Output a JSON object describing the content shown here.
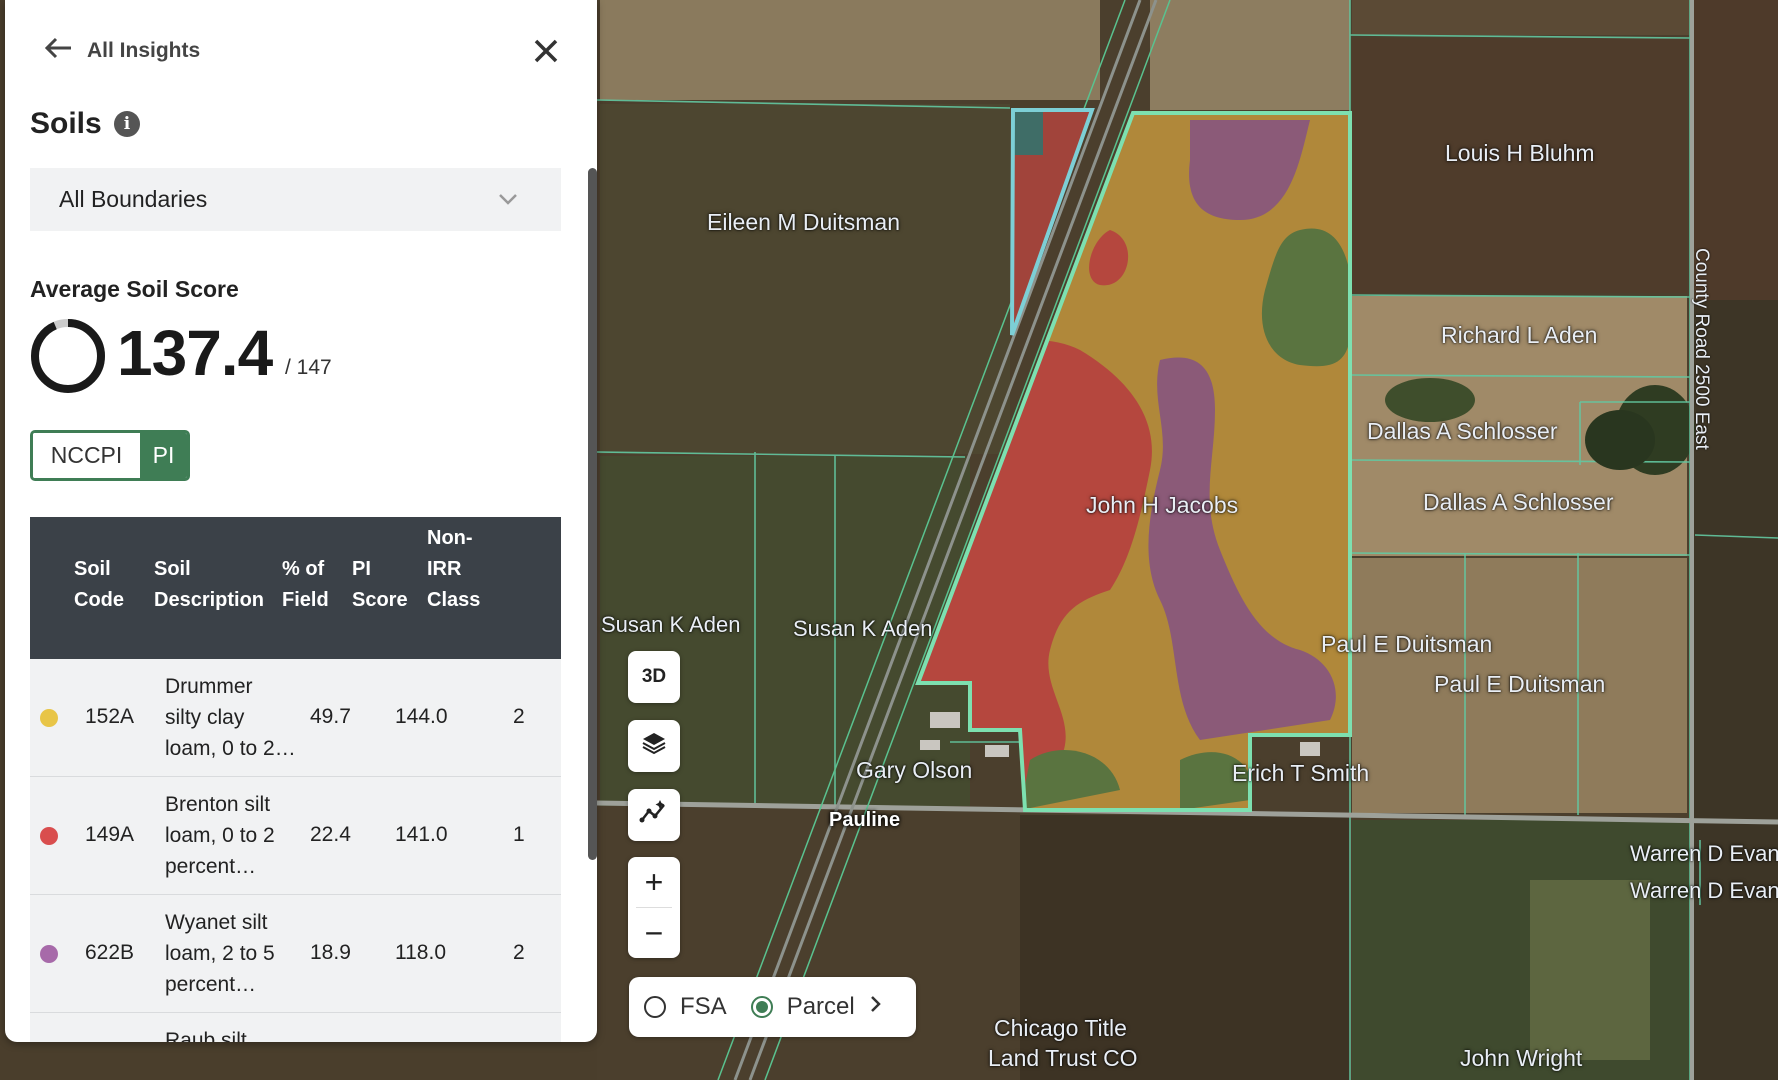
{
  "panel": {
    "back_label": "All Insights",
    "title": "Soils",
    "info_glyph": "i",
    "boundary_select": "All Boundaries",
    "avg_label": "Average Soil Score",
    "score": "137.4",
    "score_max": "/ 147",
    "score_fraction": 0.935,
    "index_toggle": {
      "option_a": "NCCPI",
      "option_b": "PI",
      "selected": "PI"
    },
    "table": {
      "headers": [
        "Soil Code",
        "Soil Description",
        "% of Field",
        "PI Score",
        "Non-IRR Class"
      ],
      "header_lines": {
        "code": [
          "Soil",
          "Code"
        ],
        "desc": [
          "Soil",
          "Description"
        ],
        "pct": [
          "% of",
          "Field"
        ],
        "score": [
          "PI",
          "Score"
        ],
        "cls": [
          "Non-",
          "IRR",
          "Class"
        ]
      },
      "rows": [
        {
          "color": "#e8c547",
          "code": "152A",
          "desc": [
            "Drummer",
            "silty clay",
            "loam, 0 to 2…"
          ],
          "pct": "49.7",
          "score": "144.0",
          "cls": "2"
        },
        {
          "color": "#d94e4e",
          "code": "149A",
          "desc": [
            "Brenton silt",
            "loam, 0 to 2",
            "percent…"
          ],
          "pct": "22.4",
          "score": "141.0",
          "cls": "1"
        },
        {
          "color": "#a76aa9",
          "code": "622B",
          "desc": [
            "Wyanet silt",
            "loam, 2 to 5",
            "percent…"
          ],
          "pct": "18.9",
          "score": "118.0",
          "cls": "2"
        },
        {
          "color": "#6a9a4a",
          "code": "",
          "desc": [
            "Raub silt"
          ],
          "pct": "",
          "score": "",
          "cls": ""
        }
      ]
    }
  },
  "map": {
    "owners": [
      "Eileen M Duitsman",
      "Louis H Bluhm",
      "Richard L Aden",
      "Dallas A Schlosser",
      "Dallas A Schlosser",
      "John H Jacobs",
      "Susan K Aden",
      "Susan K Aden",
      "Paul E Duitsman",
      "Paul E Duitsman",
      "Gary Olson",
      "Erich T Smith",
      "Warren D Evan",
      "Warren D Evan",
      "Chicago Title",
      "Land Trust CO",
      "John Wright"
    ],
    "town": "Pauline",
    "road": "County Road 2500 East",
    "controls": {
      "btn_3d": "3D",
      "zoom_in": "+",
      "zoom_out": "−"
    },
    "boundary_toggle": {
      "fsa": "FSA",
      "parcel": "Parcel",
      "selected": "Parcel"
    }
  },
  "colors": {
    "accent": "#3f7d55",
    "header": "#3b4148",
    "boundary": "#7de0b0"
  }
}
